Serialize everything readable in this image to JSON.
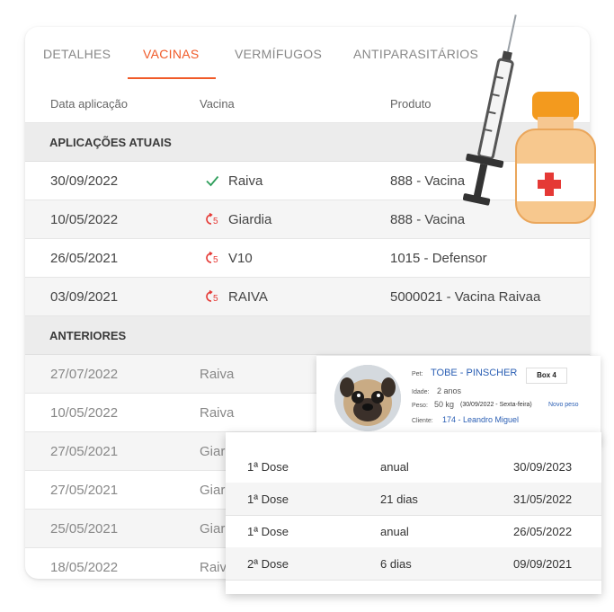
{
  "tabs": [
    {
      "label": "DETALHES",
      "active": false
    },
    {
      "label": "VACINAS",
      "active": true
    },
    {
      "label": "VERMÍFUGOS",
      "active": false
    },
    {
      "label": "ANTIPARASITÁRIOS",
      "active": false
    }
  ],
  "columns": {
    "date": "Data aplicação",
    "vaccine": "Vacina",
    "product": "Produto"
  },
  "current_section": "APLICAÇÕES ATUAIS",
  "current_rows": [
    {
      "date": "30/09/2022",
      "status": "check-icon",
      "vaccine": "Raiva",
      "product": "888 - Vacina"
    },
    {
      "date": "10/05/2022",
      "status": "pending-icon",
      "vaccine": "Giardia",
      "product": "888 - Vacina"
    },
    {
      "date": "26/05/2021",
      "status": "pending-icon",
      "vaccine": "V10",
      "product": "1015 - Defensor"
    },
    {
      "date": "03/09/2021",
      "status": "pending-icon",
      "vaccine": "RAIVA",
      "product": "5000021 - Vacina Raivaa"
    }
  ],
  "previous_section": "ANTERIORES",
  "previous_rows": [
    {
      "date": "27/07/2022",
      "vaccine": "Raiva"
    },
    {
      "date": "10/05/2022",
      "vaccine": "Raiva"
    },
    {
      "date": "27/05/2021",
      "vaccine": "Giar"
    },
    {
      "date": "27/05/2021",
      "vaccine": "Giar"
    },
    {
      "date": "25/05/2021",
      "vaccine": "Giar"
    },
    {
      "date": "18/05/2022",
      "vaccine": "Raiv"
    }
  ],
  "pet": {
    "pet_label": "Pet:",
    "name": "TOBE - PINSCHER",
    "box": "Box 4",
    "age_label": "Idade:",
    "age": "2 anos",
    "weight_label": "Peso:",
    "weight": "50 kg",
    "weight_date": "(30/09/2022 - Sexta-feira)",
    "new_weight": "Novo peso",
    "client_label": "Cliente:",
    "client": "174 - Leandro Miguel"
  },
  "doses": [
    {
      "dose": "1ª Dose",
      "interval": "anual",
      "date": "30/09/2023"
    },
    {
      "dose": "1ª Dose",
      "interval": "21 dias",
      "date": "31/05/2022"
    },
    {
      "dose": "1ª Dose",
      "interval": "anual",
      "date": "26/05/2022"
    },
    {
      "dose": "2ª Dose",
      "interval": "6 dias",
      "date": "09/09/2021"
    }
  ],
  "colors": {
    "accent": "#f05a28",
    "ok": "#2e9e5b",
    "pending": "#e53935",
    "link": "#2b5fb4"
  },
  "decorations": [
    "syringe-icon",
    "vaccine-vial-icon"
  ]
}
